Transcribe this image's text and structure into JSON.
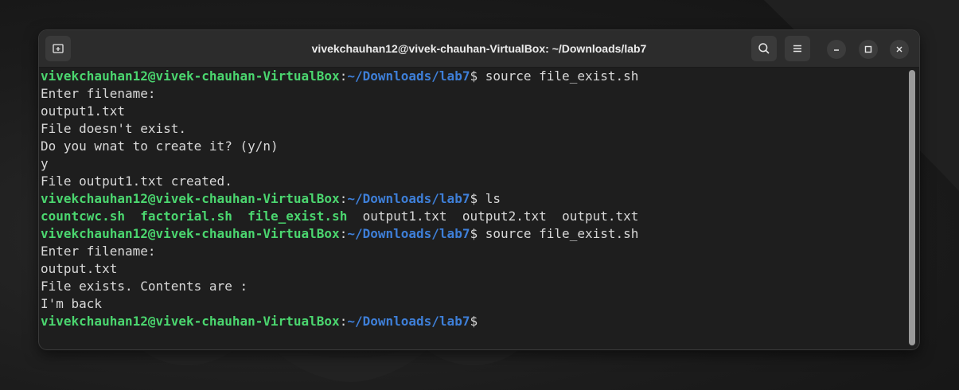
{
  "window": {
    "title": "vivekchauhan12@vivek-chauhan-VirtualBox: ~/Downloads/lab7",
    "buttons": {
      "new_tab_icon": "new-tab-icon",
      "search_icon": "search-icon",
      "menu_icon": "hamburger-menu-icon",
      "minimize_icon": "minimize-icon",
      "maximize_icon": "maximize-icon",
      "close_icon": "close-icon"
    }
  },
  "colors": {
    "user_host": "#4bd66f",
    "path": "#3e7fd8",
    "text": "#d8d8d8",
    "background": "#1e1e1e"
  },
  "prompt": {
    "user_host": "vivekchauhan12@vivek-chauhan-VirtualBox",
    "colon": ":",
    "path": "~/Downloads/lab7",
    "dollar": "$"
  },
  "terminal": {
    "cmd1": " source file_exist.sh",
    "out1": "Enter filename:",
    "out2": "output1.txt",
    "out3": "File doesn't exist.",
    "out4": "Do you wnat to create it? (y/n)",
    "out5": "y",
    "out6": "File output1.txt created.",
    "cmd2": " ls",
    "ls": {
      "exec1": "countcwc.sh",
      "exec2": "factorial.sh",
      "exec3": "file_exist.sh",
      "file1": "output1.txt",
      "file2": "output2.txt",
      "file3": "output.txt"
    },
    "cmd3": " source file_exist.sh",
    "out7": "Enter filename:",
    "out8": "output.txt",
    "out9": "File exists. Contents are :",
    "out10": "I'm back"
  }
}
